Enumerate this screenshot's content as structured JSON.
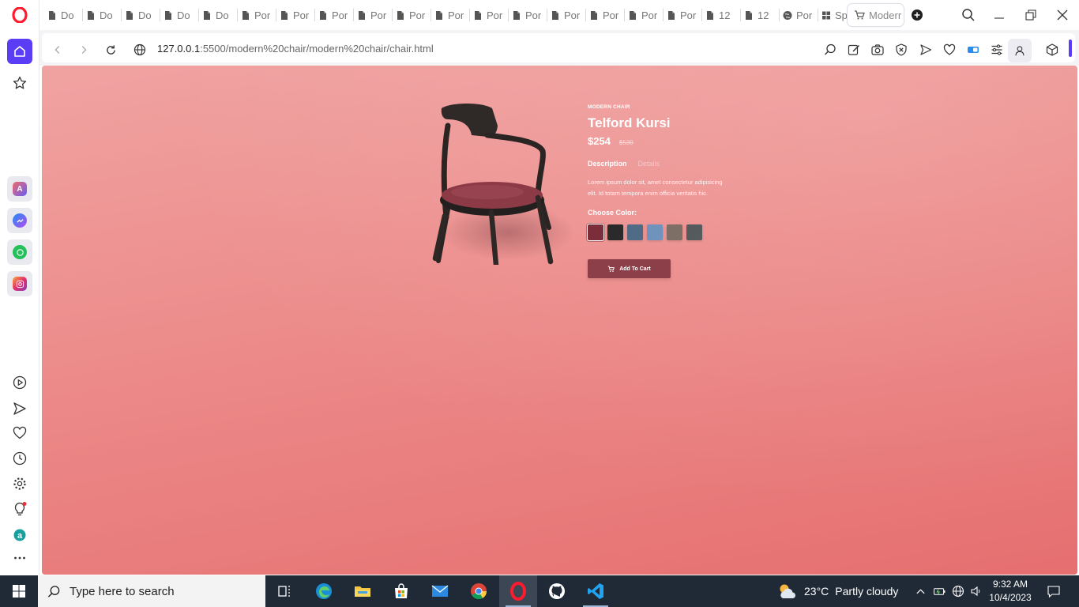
{
  "browser": {
    "tabs": [
      {
        "label": "Do",
        "icon": "document-icon"
      },
      {
        "label": "Do",
        "icon": "document-icon"
      },
      {
        "label": "Do",
        "icon": "document-icon"
      },
      {
        "label": "Do",
        "icon": "document-icon"
      },
      {
        "label": "Do",
        "icon": "document-icon"
      },
      {
        "label": "Por",
        "icon": "document-icon"
      },
      {
        "label": "Por",
        "icon": "document-icon"
      },
      {
        "label": "Por",
        "icon": "document-icon"
      },
      {
        "label": "Por",
        "icon": "document-icon"
      },
      {
        "label": "Por",
        "icon": "document-icon"
      },
      {
        "label": "Por",
        "icon": "document-icon"
      },
      {
        "label": "Por",
        "icon": "document-icon"
      },
      {
        "label": "Por",
        "icon": "document-icon"
      },
      {
        "label": "Por",
        "icon": "document-icon"
      },
      {
        "label": "Por",
        "icon": "document-icon"
      },
      {
        "label": "Por",
        "icon": "document-icon"
      },
      {
        "label": "Por",
        "icon": "document-icon"
      },
      {
        "label": "12",
        "icon": "document-icon"
      },
      {
        "label": "12",
        "icon": "document-icon"
      },
      {
        "label": "Por",
        "icon": "globe-icon"
      },
      {
        "label": "Sp",
        "icon": "grid-icon"
      }
    ],
    "active_tab": {
      "label": "Moderr",
      "icon": "cart-icon"
    },
    "url_host": "127.0.0.1",
    "url_path": ":5500/modern%20chair/modern%20chair/chair.html"
  },
  "product": {
    "category": "MODERN CHAIR",
    "name": "Telford Kursi",
    "price": "$254",
    "old_price": "$530",
    "tab_description": "Description",
    "tab_details": "Details",
    "description": "Lorem ipsum dolor sit, amet consectetur adipisicing elit. Id totam tempora enim officia veritatis hic.",
    "choose_color_label": "Choose Color:",
    "colors": [
      "#7b2d3a",
      "#2a2a2a",
      "#4f6b86",
      "#6f93bc",
      "#7d6f66",
      "#555a5c"
    ],
    "add_to_cart": "Add To Cart"
  },
  "taskbar": {
    "search_placeholder": "Type here to search",
    "temperature": "23°C",
    "weather": "Partly cloudy",
    "time": "9:32 AM",
    "date": "10/4/2023"
  }
}
